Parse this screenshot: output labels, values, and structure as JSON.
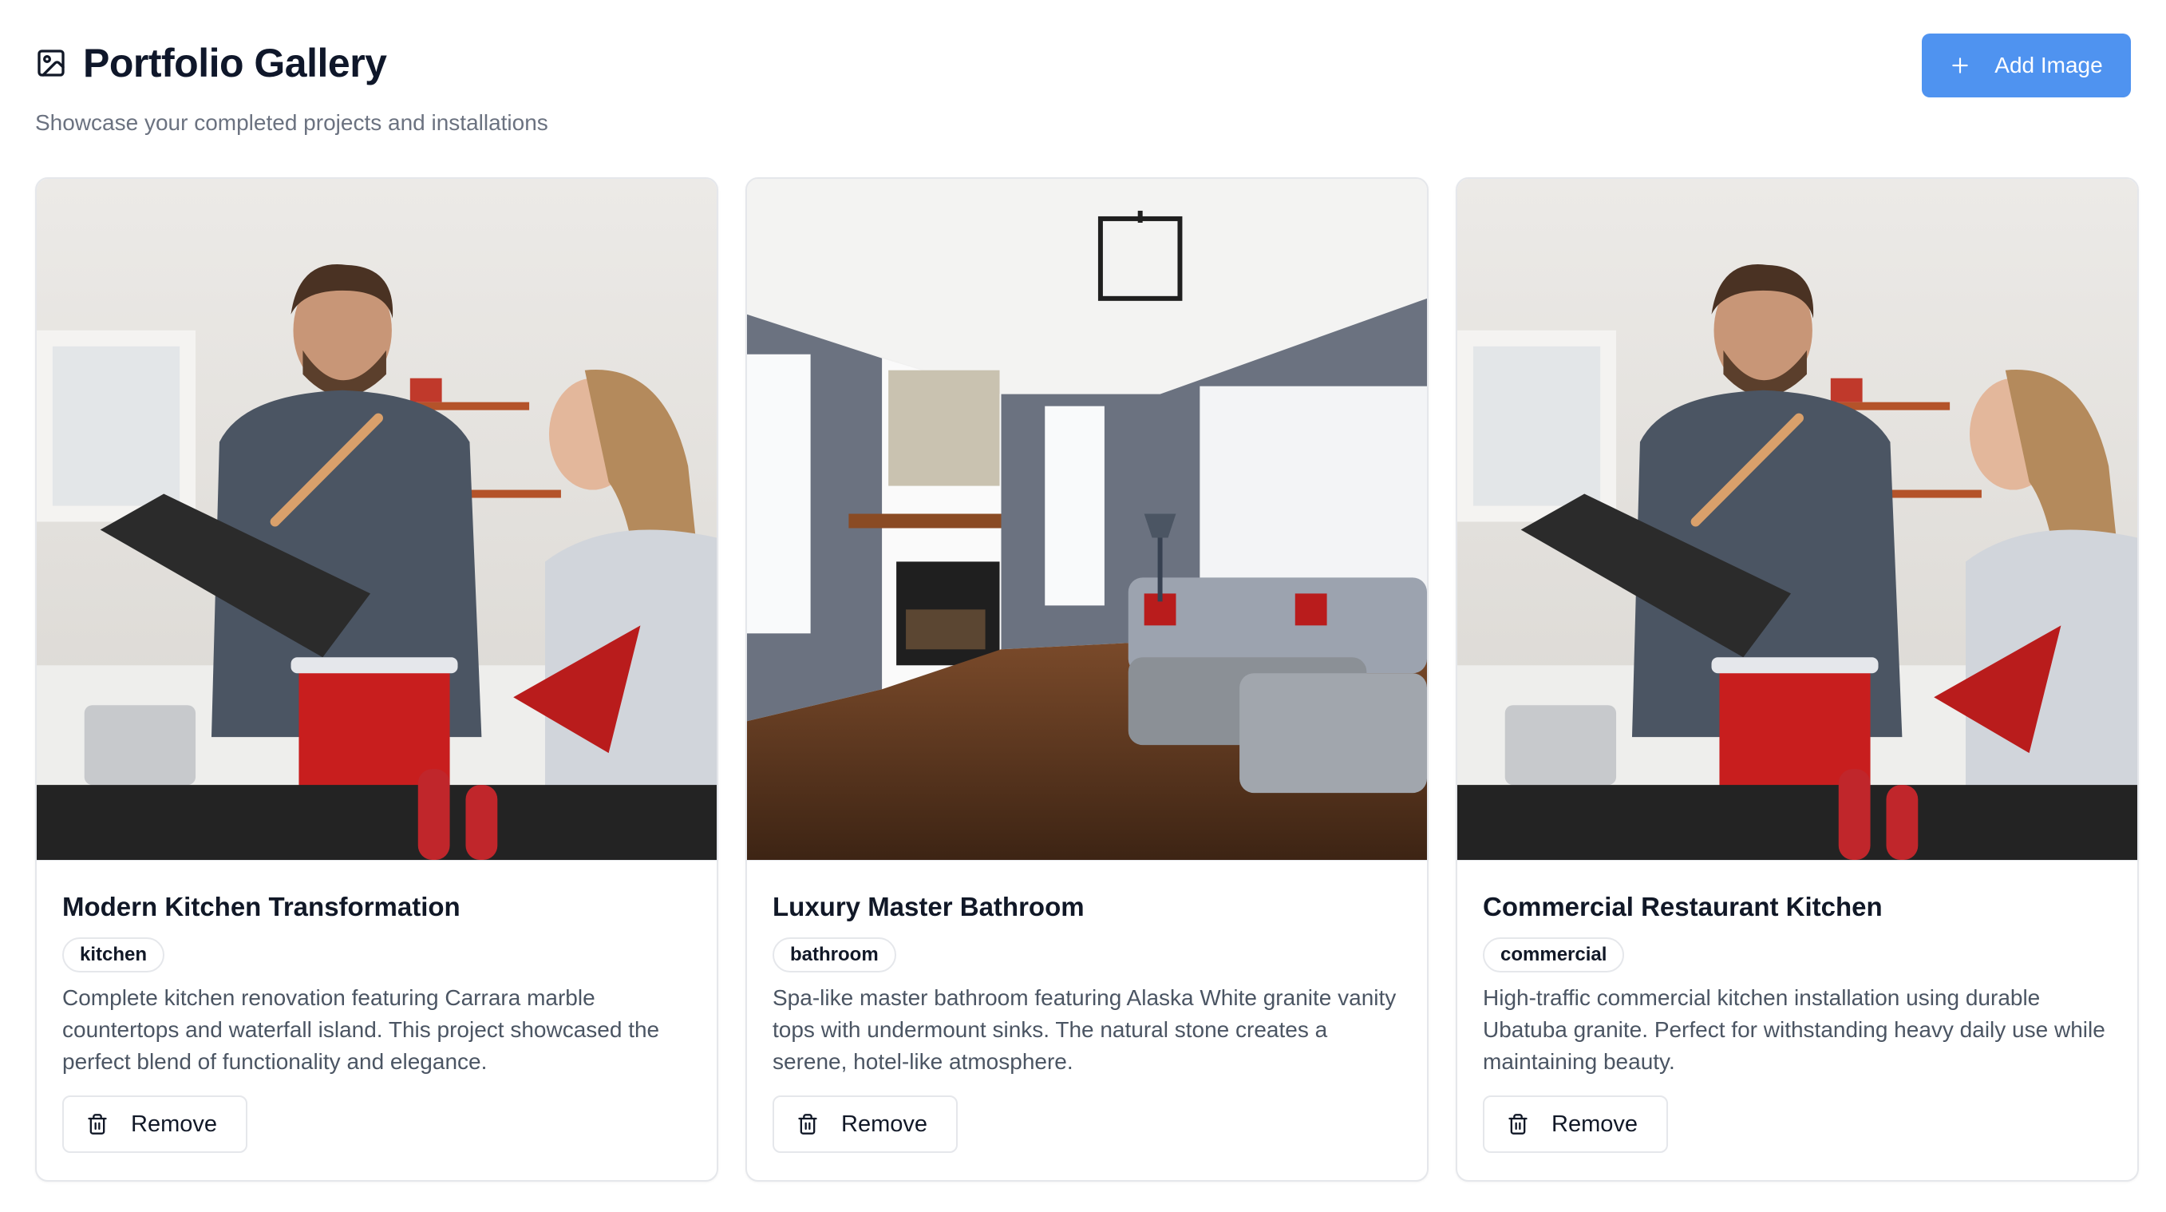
{
  "header": {
    "title": "Portfolio Gallery",
    "subtitle": "Showcase your completed projects and installations",
    "title_icon": "image-icon",
    "add_button_label": "Add Image",
    "add_button_icon": "plus-icon"
  },
  "colors": {
    "accent": "#4f93f0",
    "border": "#e5e7eb",
    "muted_text": "#6b7280"
  },
  "gallery": {
    "items": [
      {
        "title": "Modern Kitchen Transformation",
        "tag": "kitchen",
        "description": "Complete kitchen renovation featuring Carrara marble countertops and waterfall island. This project showcased the perfect blend of functionality and elegance.",
        "remove_label": "Remove",
        "image": "photo of couple cooking in a kitchen"
      },
      {
        "title": "Luxury Master Bathroom",
        "tag": "bathroom",
        "description": "Spa-like master bathroom featuring Alaska White granite vanity tops with undermount sinks. The natural stone creates a serene, hotel-like atmosphere.",
        "remove_label": "Remove",
        "image": "photo of living room with fireplace and grey sectional sofa"
      },
      {
        "title": "Commercial Restaurant Kitchen",
        "tag": "commercial",
        "description": "High-traffic commercial kitchen installation using durable Ubatuba granite. Perfect for withstanding heavy daily use while maintaining beauty.",
        "remove_label": "Remove",
        "image": "photo of couple cooking in a kitchen"
      }
    ]
  }
}
